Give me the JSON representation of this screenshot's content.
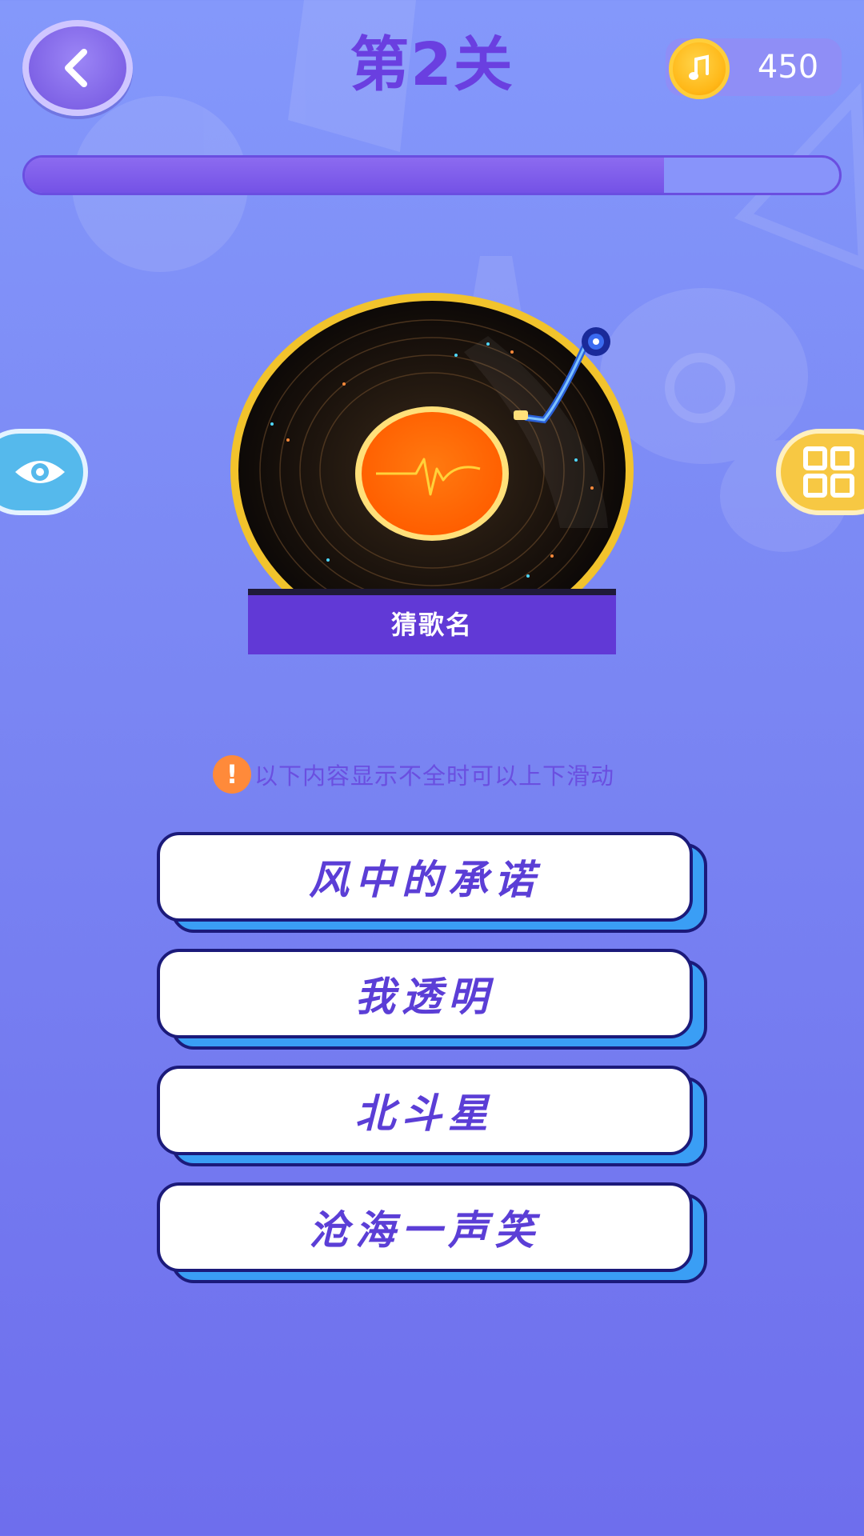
{
  "header": {
    "level_title": "第2关",
    "coins": "450"
  },
  "progress": {
    "value_fraction": 0.785
  },
  "record": {
    "label": "猜歌名"
  },
  "hint": {
    "icon": "!",
    "text": "以下内容显示不全时可以上下滑动"
  },
  "options": [
    {
      "label": "风中的承诺"
    },
    {
      "label": "我透明"
    },
    {
      "label": "北斗星"
    },
    {
      "label": "沧海一声笑"
    }
  ],
  "colors": {
    "background_top": "#8498fb",
    "background_bottom": "#6e6eed",
    "accent_purple": "#6139d6",
    "title_purple": "#6a3fe0",
    "option_shadow_blue": "#3a9ef5",
    "option_border": "#1b1a7a",
    "coin_gold": "#ffb818",
    "eye_button_blue": "#55b9ec",
    "grid_button_yellow": "#f7c843",
    "hint_orange": "#ff8a3a"
  },
  "icons": {
    "back": "chevron-left-icon",
    "coin": "music-note-coin-icon",
    "eye": "eye-icon",
    "grid": "grid-icon",
    "record": "vinyl-record-icon"
  }
}
